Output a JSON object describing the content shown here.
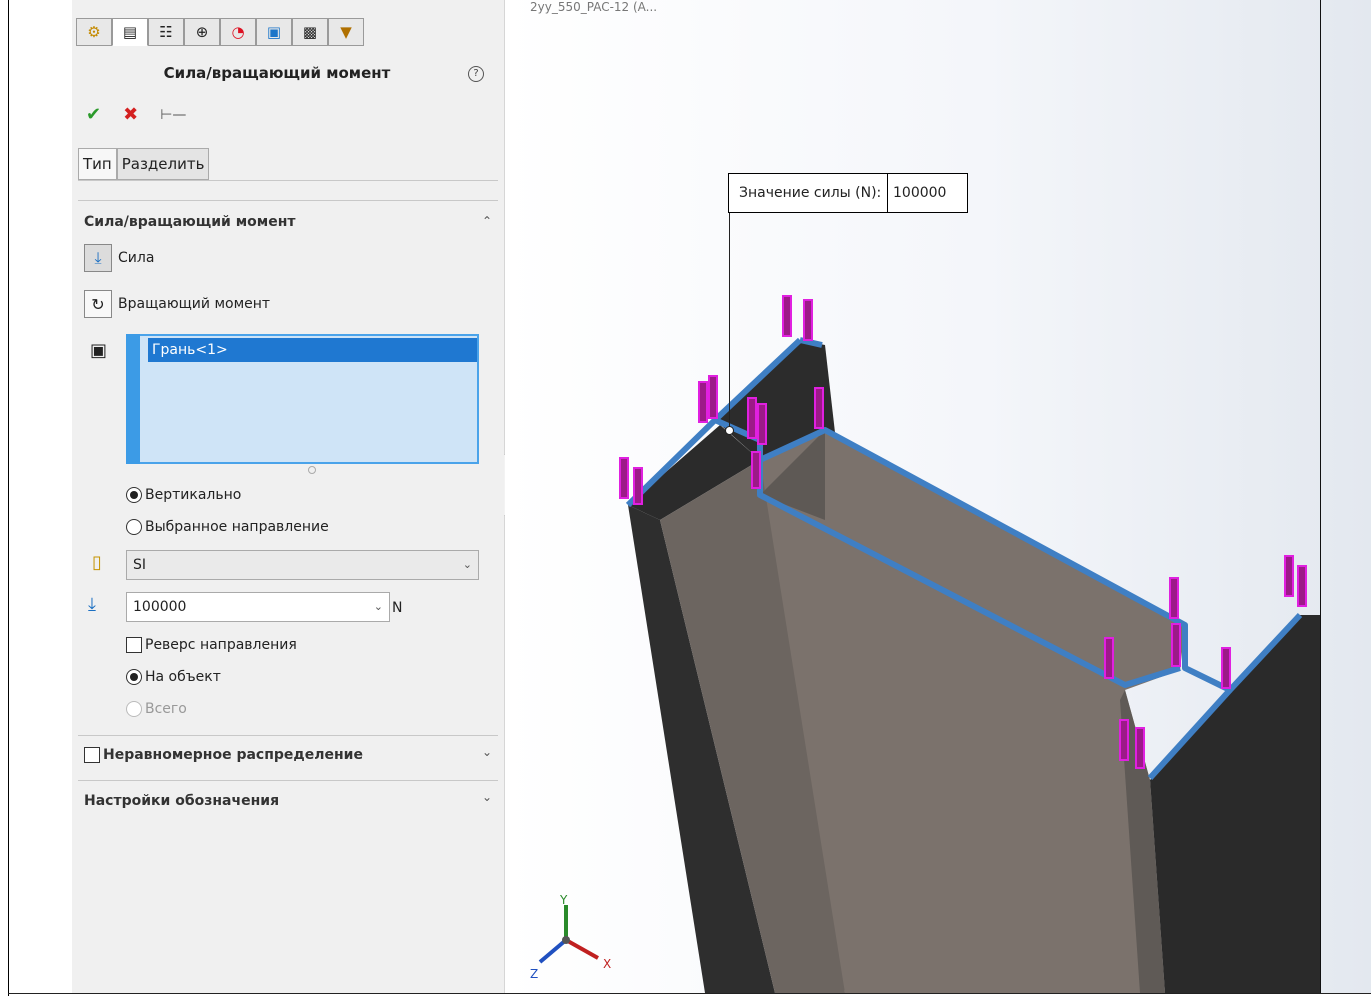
{
  "header": {
    "ghost_title": "2yy_550_PAC-12 (A..."
  },
  "panel": {
    "tabs": [
      "feature-manager",
      "property-manager",
      "configuration-manager",
      "dimxpert-manager",
      "display-manager",
      "simulation-study",
      "cam",
      "sensors"
    ],
    "title": "Сила/вращающий момент",
    "help": "?",
    "subtabs": [
      "Тип",
      "Разделить"
    ],
    "force_section": {
      "title": "Сила/вращающий момент",
      "force_label": "Сила",
      "torque_label": "Вращающий момент",
      "selection_item": "Грань<1>",
      "normal_label": "Вертикально",
      "direction_label": "Выбранное направление",
      "units": "SI",
      "force_value": "100000",
      "force_unit": "N",
      "reverse_label": "Реверс направления",
      "per_item_label": "На объект",
      "total_label": "Всего"
    },
    "nonuniform_label": "Неравномерное распределение",
    "symbol_settings_label": "Настройки обозначения"
  },
  "viewport": {
    "callout_label": "Значение силы (N):",
    "callout_value": "100000",
    "triad": {
      "x": "X",
      "y": "Y",
      "z": "Z"
    }
  }
}
